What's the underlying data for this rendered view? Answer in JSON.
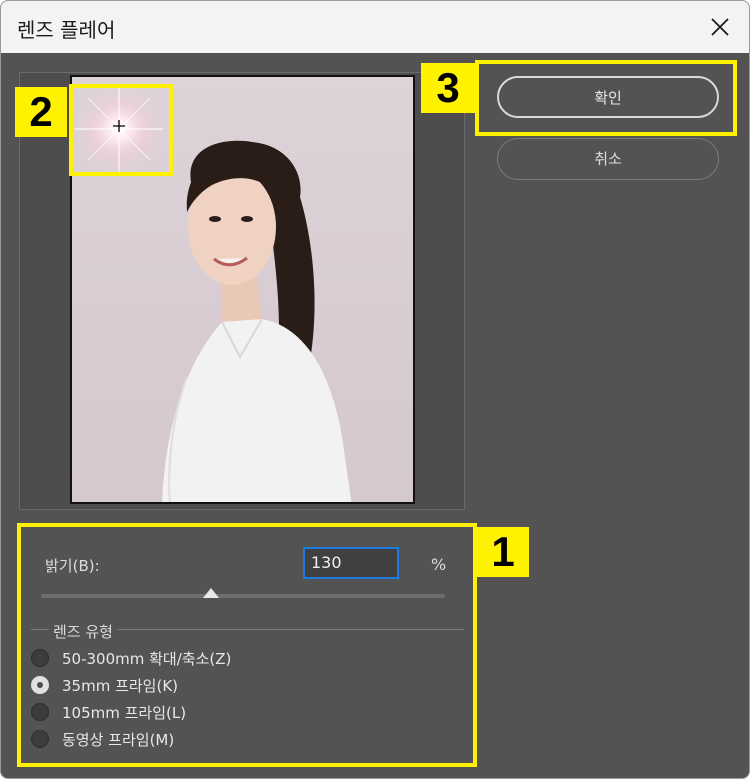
{
  "window": {
    "title": "렌즈 플레어"
  },
  "buttons": {
    "ok": "확인",
    "cancel": "취소"
  },
  "brightness": {
    "label": "밝기(B):",
    "value": "130",
    "unit": "%",
    "slider_fraction": 0.42
  },
  "lens_type": {
    "title": "렌즈 유형",
    "options": [
      {
        "label": "50-300mm 확대/축소(Z)",
        "selected": false
      },
      {
        "label": "35mm 프라임(K)",
        "selected": true
      },
      {
        "label": "105mm 프라임(L)",
        "selected": false
      },
      {
        "label": "동영상 프라임(M)",
        "selected": false
      }
    ]
  },
  "callouts": {
    "one": "1",
    "two": "2",
    "three": "3"
  },
  "colors": {
    "highlight": "#fff200",
    "panel": "#535353",
    "focus": "#1f7ae0"
  }
}
